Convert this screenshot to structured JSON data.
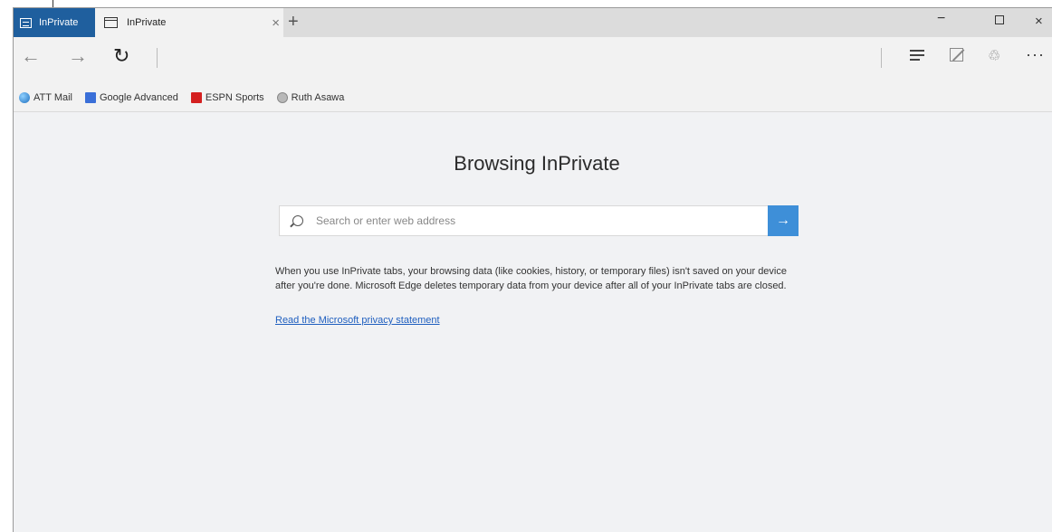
{
  "titlebar": {
    "badge_label": "InPrivate",
    "tab_title": "InPrivate",
    "tab_close": "×",
    "new_tab": "+",
    "minimize": "−",
    "close": "×"
  },
  "navbar": {
    "back": "←",
    "forward": "→",
    "refresh": "↻",
    "share": "♲",
    "more": "···"
  },
  "favorites": [
    {
      "label": "ATT Mail",
      "icon": "globe-icon"
    },
    {
      "label": "Google Advanced",
      "icon": "google-icon"
    },
    {
      "label": "ESPN Sports",
      "icon": "espn-icon"
    },
    {
      "label": "Ruth Asawa",
      "icon": "ruth-icon"
    }
  ],
  "main": {
    "heading": "Browsing InPrivate",
    "search_placeholder": "Search or enter web address",
    "go_arrow": "→",
    "info": "When you use InPrivate tabs, your browsing data (like cookies, history, or temporary files) isn't saved on your device after you're done. Microsoft Edge deletes temporary data from your device after all of your InPrivate tabs are closed.",
    "privacy_link": "Read the Microsoft privacy statement"
  },
  "colors": {
    "inprivate_badge": "#1f5f9e",
    "go_button": "#3e8fd8",
    "link": "#1f5fbf"
  }
}
